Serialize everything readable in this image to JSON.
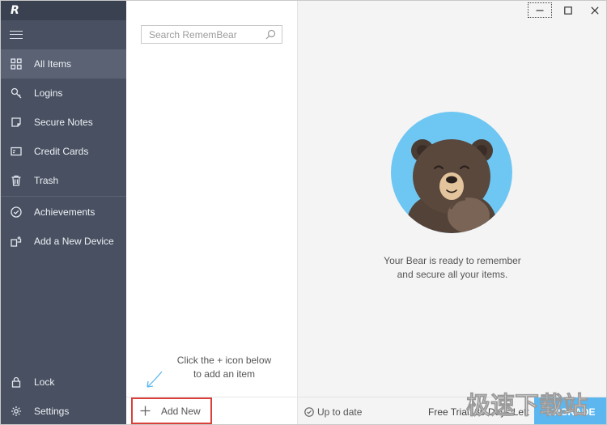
{
  "app": {
    "logo": "R"
  },
  "sidebar": {
    "items": [
      {
        "label": "All Items",
        "icon": "grid-icon",
        "active": true
      },
      {
        "label": "Logins",
        "icon": "key-icon"
      },
      {
        "label": "Secure Notes",
        "icon": "note-icon"
      },
      {
        "label": "Credit Cards",
        "icon": "credit-card-icon"
      },
      {
        "label": "Trash",
        "icon": "trash-icon"
      },
      {
        "label": "Achievements",
        "icon": "check-circle-icon"
      },
      {
        "label": "Add a New Device",
        "icon": "add-device-icon"
      }
    ],
    "bottom": [
      {
        "label": "Lock",
        "icon": "lock-icon"
      },
      {
        "label": "Settings",
        "icon": "gear-icon"
      }
    ]
  },
  "list": {
    "search_placeholder": "Search RememBear",
    "hint_line1": "Click the + icon below",
    "hint_line2": "to add an item",
    "add_new": "Add New"
  },
  "content": {
    "message_line1": "Your Bear is ready to remember",
    "message_line2": "and secure all your items.",
    "status": "Up to date",
    "trial": "Free Trial: 30 Days Left",
    "upgrade": "UPGRADE"
  },
  "watermark": {
    "text": "极速下载站"
  },
  "colors": {
    "sidebar_bg": "#485061",
    "sidebar_active": "#5a6274",
    "accent_blue": "#5cb6f0",
    "bear_bg": "#6ec6f2",
    "highlight_red": "#d9403a"
  }
}
